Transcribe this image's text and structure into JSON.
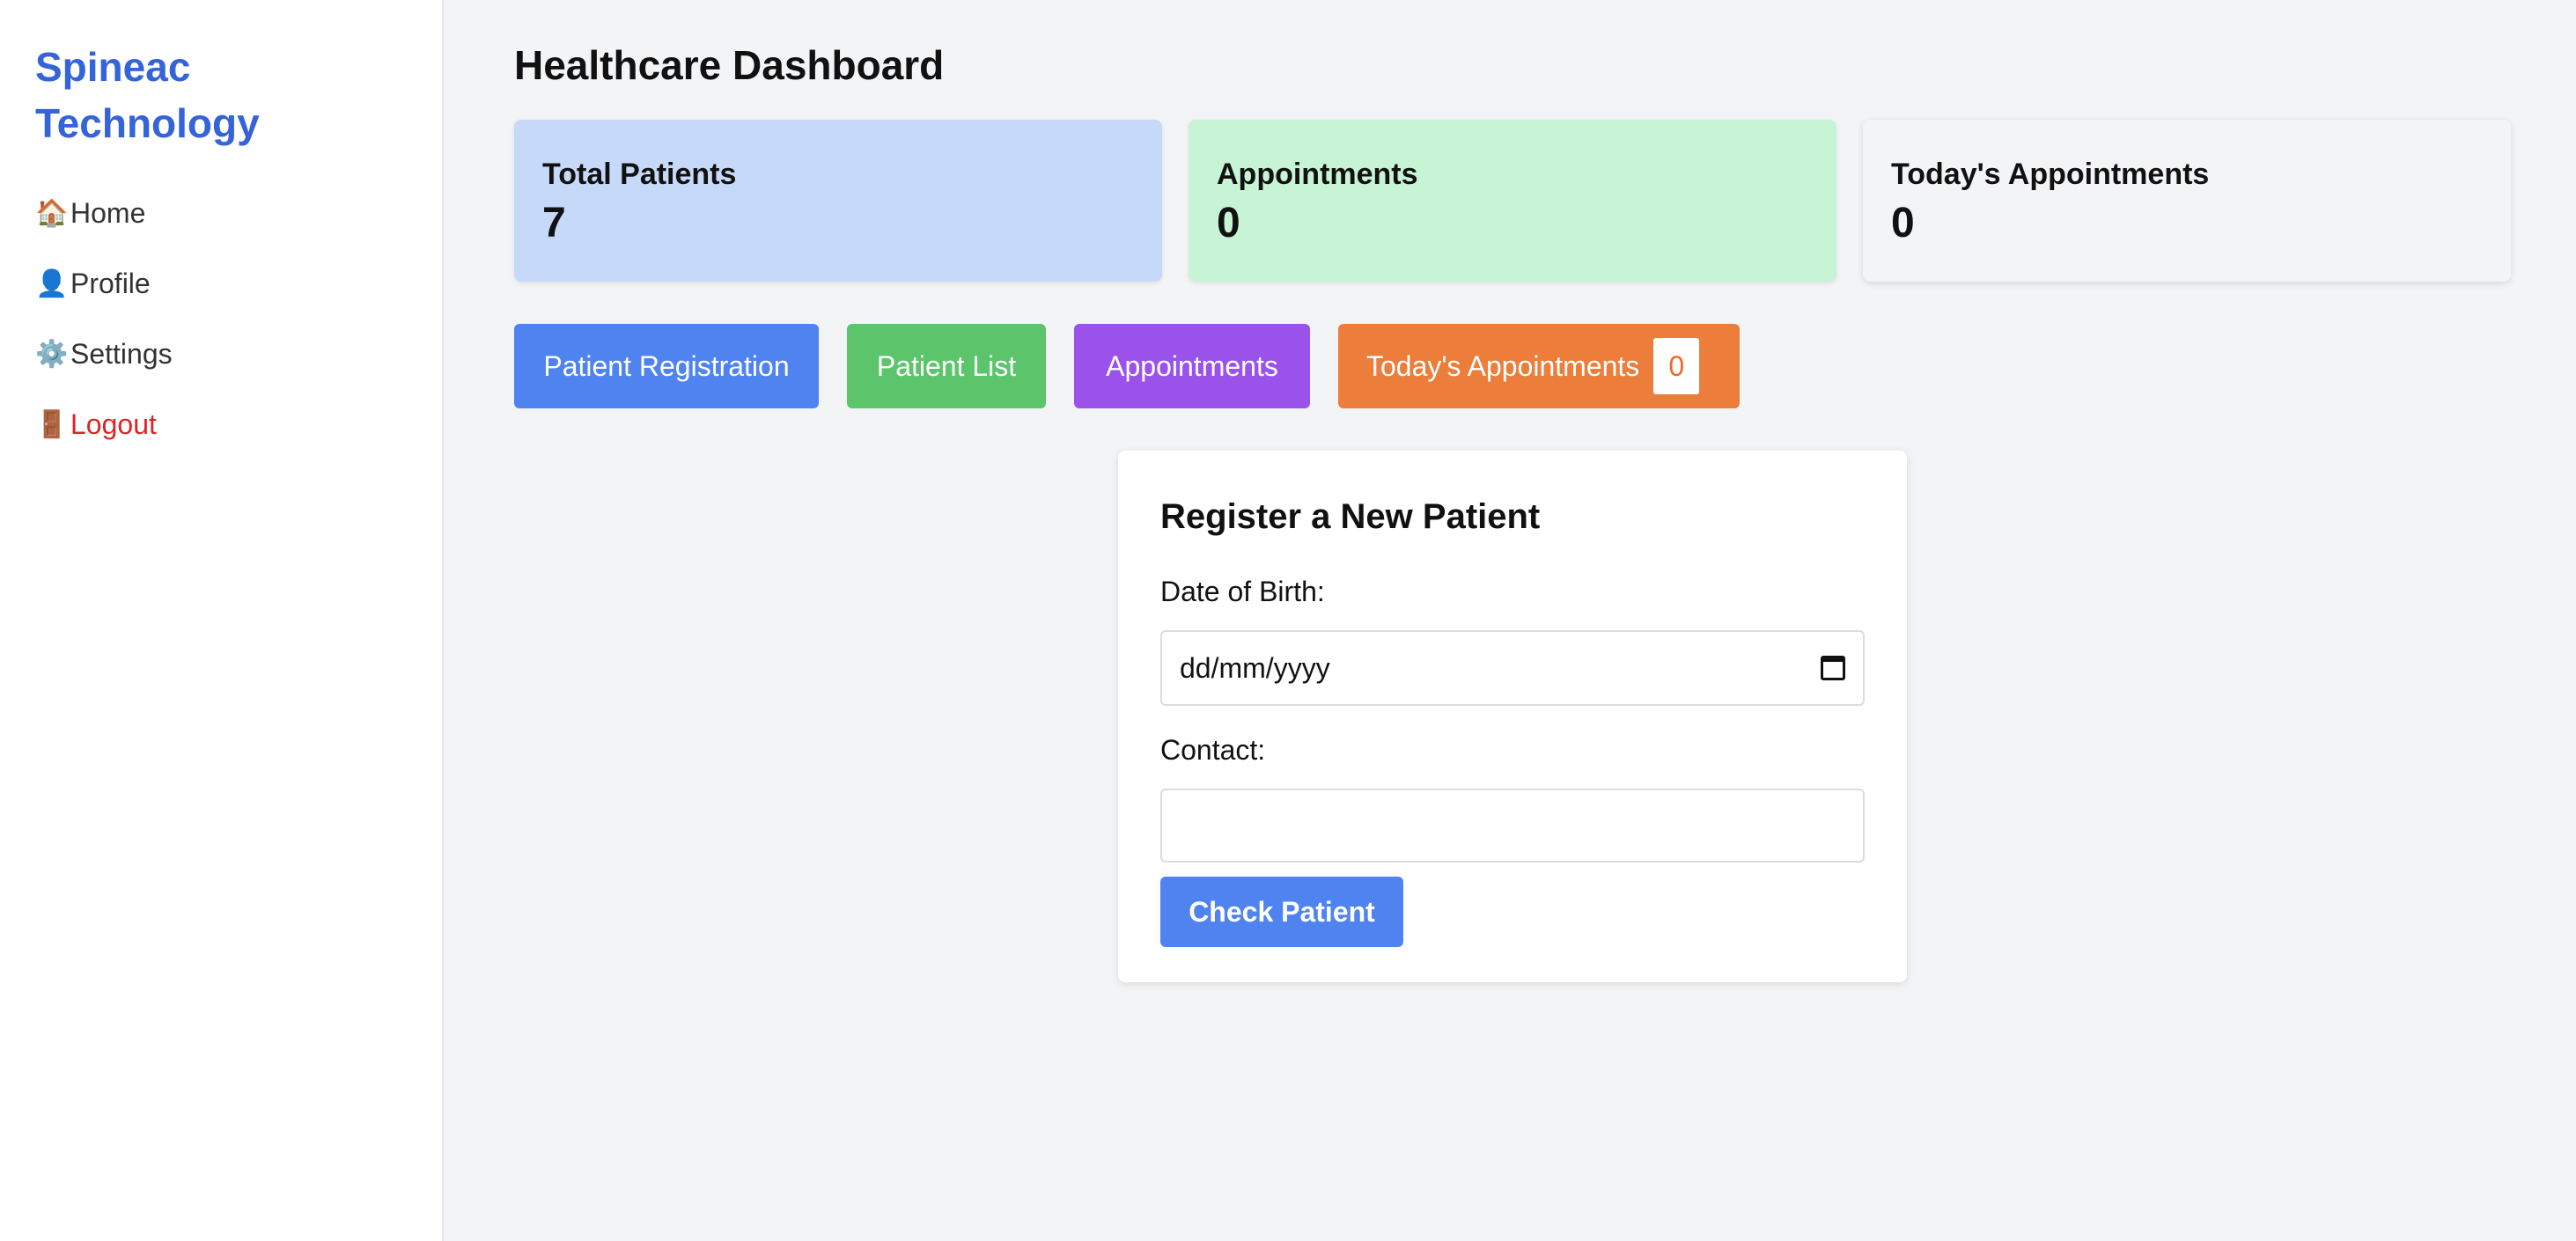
{
  "sidebar": {
    "brand": "Spineac Technology",
    "items": [
      {
        "icon": "🏠",
        "icon_name": "home-icon",
        "label": "Home"
      },
      {
        "icon": "👤",
        "icon_name": "profile-icon",
        "label": "Profile"
      },
      {
        "icon": "⚙️",
        "icon_name": "gear-icon",
        "label": "Settings"
      },
      {
        "icon": "🚪",
        "icon_name": "door-icon",
        "label": "Logout"
      }
    ]
  },
  "main": {
    "title": "Healthcare Dashboard",
    "stats": [
      {
        "label": "Total Patients",
        "value": "7",
        "color": "#c6d9f9"
      },
      {
        "label": "Appointments",
        "value": "0",
        "color": "#c7f4d5"
      },
      {
        "label": "Today's Appointments",
        "value": "0",
        "color": "#f3f4f6"
      }
    ],
    "buttons": {
      "registration": "Patient Registration",
      "list": "Patient List",
      "appointments": "Appointments",
      "today": "Today's Appointments",
      "today_badge": "0"
    },
    "form": {
      "title": "Register a New Patient",
      "dob_label": "Date of Birth:",
      "dob_placeholder": "dd/mm/yyyy",
      "contact_label": "Contact:",
      "contact_value": "",
      "submit_label": "Check Patient"
    }
  },
  "colors": {
    "brand": "#3563d8",
    "primary": "#4f83ef",
    "success": "#5cc46b",
    "purple": "#9b52eb",
    "orange": "#ec7d3a",
    "danger": "#dc2626"
  }
}
